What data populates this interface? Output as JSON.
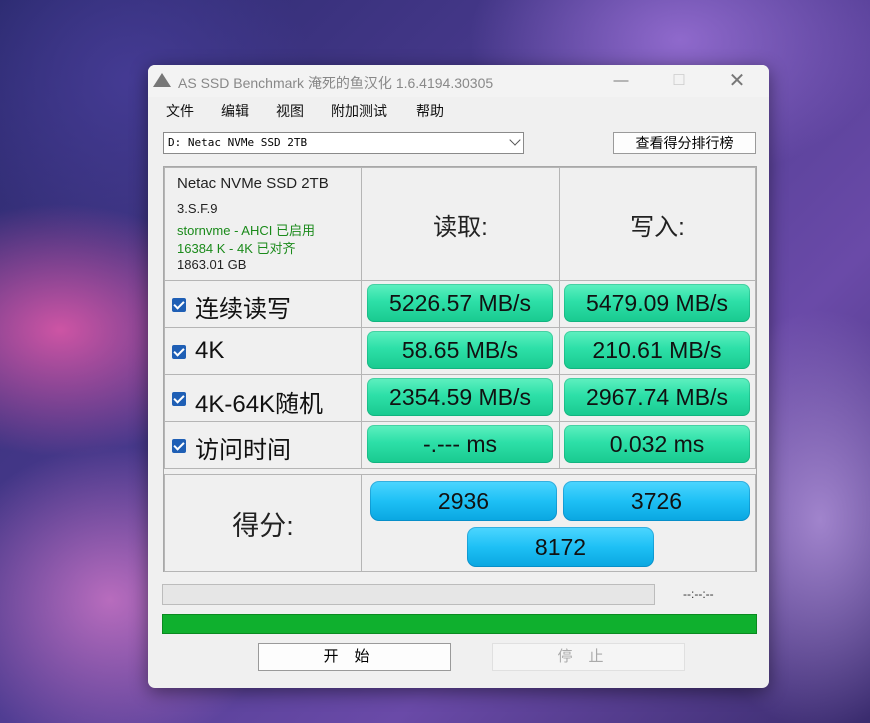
{
  "window": {
    "title": "AS SSD Benchmark 淹死的鱼汉化 1.6.4194.30305",
    "minimize": "—",
    "maximize": "☐",
    "close": "✕"
  },
  "menu": [
    "文件",
    "编辑",
    "视图",
    "附加测试",
    "帮助"
  ],
  "drive_select": {
    "value": "D: Netac NVMe SSD 2TB"
  },
  "rank_button": "查看得分排行榜",
  "drive_info": {
    "model": "Netac NVMe SSD 2TB",
    "firmware": "3.S.F.9",
    "driver": "stornvme - AHCI 已启用",
    "alignment": "16384 K - 4K 已对齐",
    "capacity": "1863.01 GB"
  },
  "headers": {
    "read": "读取:",
    "write": "写入:"
  },
  "tests": [
    {
      "label": "连续读写",
      "read": "5226.57 MB/s",
      "write": "5479.09 MB/s"
    },
    {
      "label": "4K",
      "read": "58.65 MB/s",
      "write": "210.61 MB/s"
    },
    {
      "label": "4K-64K随机",
      "read": "2354.59 MB/s",
      "write": "2967.74 MB/s"
    },
    {
      "label": "访问时间",
      "read": "-.--- ms",
      "write": "0.032 ms"
    }
  ],
  "score": {
    "label": "得分:",
    "read": "2936",
    "write": "3726",
    "total": "8172"
  },
  "timer": "--:--:--",
  "progress": 1.0,
  "buttons": {
    "start": "开始",
    "stop": "停止"
  },
  "colors": {
    "result_green": "#2de0a8",
    "score_blue": "#1ec0f5",
    "progress_green": "#0fb02e",
    "checkbox_blue": "#1f5fb5"
  },
  "icons": [
    "app-triangle-icon",
    "chevron-down-icon",
    "checkbox-checked-icon"
  ]
}
